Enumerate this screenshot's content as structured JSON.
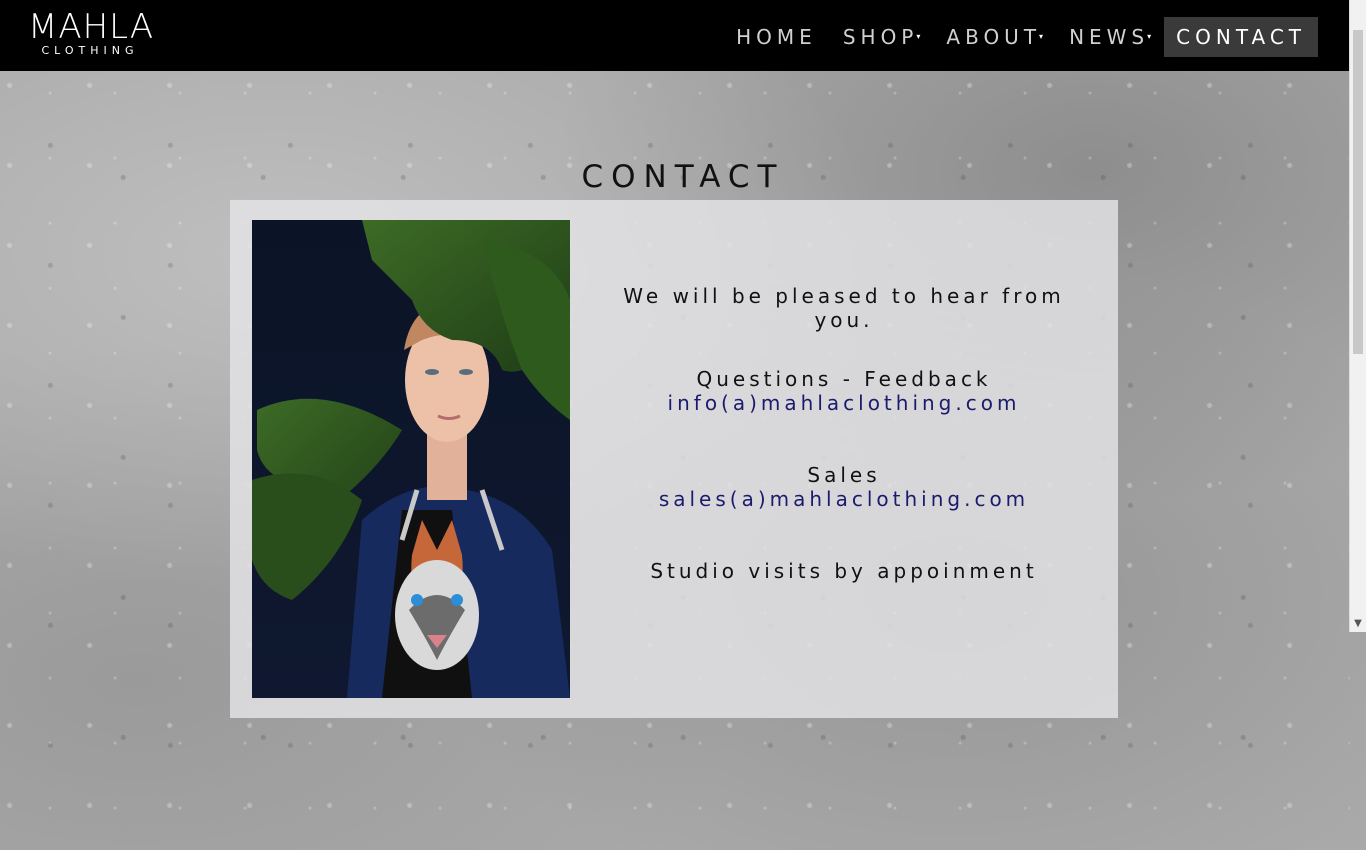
{
  "brand": {
    "logo_main": "MAHLA",
    "logo_sub": "CLOTHING"
  },
  "nav": {
    "items": [
      {
        "label": "HOME",
        "has_dropdown": false
      },
      {
        "label": "SHOP",
        "has_dropdown": true
      },
      {
        "label": "ABOUT",
        "has_dropdown": true
      },
      {
        "label": "NEWS",
        "has_dropdown": true
      },
      {
        "label": "CONTACT",
        "has_dropdown": false,
        "active": true
      }
    ],
    "caret": "▾"
  },
  "page": {
    "title": "CONTACT"
  },
  "contact": {
    "intro": "We will be pleased to hear from you.",
    "questions_label": "Questions - Feedback",
    "questions_email": "info(a)mahlaclothing.com",
    "sales_label": "Sales",
    "sales_email": "sales(a)mahlaclothing.com",
    "studio_note": "Studio visits by appoinment"
  },
  "colors": {
    "header_bg": "#000000",
    "active_nav_bg": "#3a3a3a",
    "link": "#1b1b6e"
  }
}
